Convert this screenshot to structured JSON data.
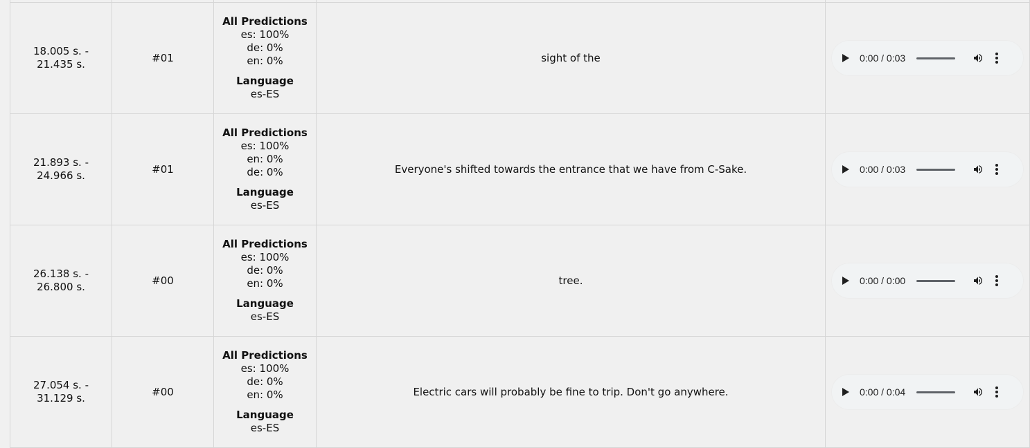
{
  "rows": [
    {
      "time": "",
      "speaker": "",
      "predictions_title": "",
      "predictions": [],
      "language_title": "",
      "language": "",
      "text": "",
      "audio_time": "",
      "hidden": true
    },
    {
      "time": "18.005 s. - 21.435 s.",
      "speaker": "#01",
      "predictions_title": "All Predictions",
      "predictions": [
        "es: 100%",
        "de: 0%",
        "en: 0%"
      ],
      "language_title": "Language",
      "language": "es-ES",
      "text": "sight of the",
      "audio_time": "0:00 / 0:03"
    },
    {
      "time": "21.893 s. - 24.966 s.",
      "speaker": "#01",
      "predictions_title": "All Predictions",
      "predictions": [
        "es: 100%",
        "en: 0%",
        "de: 0%"
      ],
      "language_title": "Language",
      "language": "es-ES",
      "text": "Everyone's shifted towards the entrance that we have from C-Sake.",
      "audio_time": "0:00 / 0:03"
    },
    {
      "time": "26.138 s. - 26.800 s.",
      "speaker": "#00",
      "predictions_title": "All Predictions",
      "predictions": [
        "es: 100%",
        "de: 0%",
        "en: 0%"
      ],
      "language_title": "Language",
      "language": "es-ES",
      "text": "tree.",
      "audio_time": "0:00 / 0:00"
    },
    {
      "time": "27.054 s. - 31.129 s.",
      "speaker": "#00",
      "predictions_title": "All Predictions",
      "predictions": [
        "es: 100%",
        "de: 0%",
        "en: 0%"
      ],
      "language_title": "Language",
      "language": "es-ES",
      "text": "Electric cars will probably be fine to trip. Don't go anywhere.",
      "audio_time": "0:00 / 0:04"
    }
  ],
  "icons": {
    "play": "play-icon",
    "volume": "volume-icon",
    "menu": "more-vert-icon"
  },
  "colors": {
    "background": "#f0f0f0",
    "border": "#d6d6d6",
    "player_bg": "#f1f3f4",
    "icon": "#1f1f1f"
  }
}
